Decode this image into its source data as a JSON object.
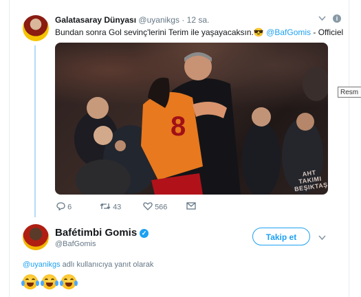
{
  "tweet1": {
    "display_name": "Galatasaray Dünyası",
    "handle": "@uyanikgs",
    "separator": "·",
    "time": "12 sa.",
    "text_before": "Bundan sonra Gol sevinç'lerini Terim ile yaşayacaksın.",
    "emoji": "😎",
    "mention": "@BafGomis",
    "text_after": "- Officiel",
    "media_watermark": "AHT TAKIMI BEŞIKTAŞ",
    "actions": {
      "reply_count": "6",
      "retweet_count": "43",
      "like_count": "566"
    }
  },
  "tooltip": "Resm",
  "tweet2": {
    "display_name": "Bafétimbi Gomis",
    "handle": "@BafGomis",
    "follow_label": "Takip et",
    "reply_context_mention": "@uyanikgs",
    "reply_context_text": "adlı kullanıcıya yanıt olarak",
    "emojis": [
      "😂",
      "😂",
      "😂"
    ]
  },
  "icons": [
    "reply-icon",
    "retweet-icon",
    "like-icon",
    "dm-icon",
    "chevron-down-icon",
    "info-icon",
    "verified-icon"
  ],
  "colors": {
    "accent": "#1da1f2",
    "muted": "#657786",
    "thread_line": "#b3dcf7"
  }
}
